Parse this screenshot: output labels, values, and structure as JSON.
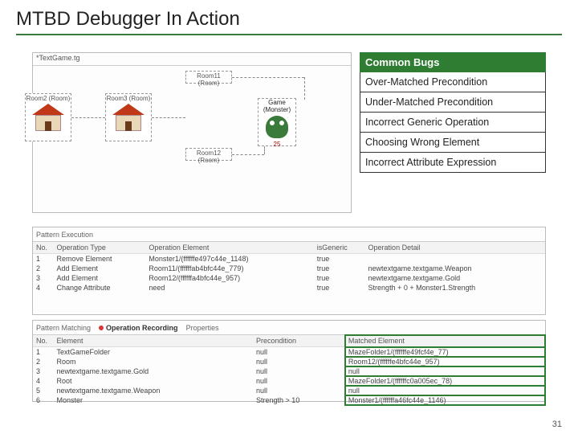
{
  "title": "MTBD Debugger In Action",
  "canvas_tab": "*TextGame.tg",
  "rooms": {
    "r2": "Room2 (Room)",
    "r3": "Room3 (Room)",
    "r11": "Room11 (Room)",
    "r12": "Room12 (Room)"
  },
  "monster": {
    "label": "Game (Monster)",
    "hp": "25"
  },
  "bugs": {
    "header": "Common Bugs",
    "items": [
      "Over-Matched Precondition",
      "Under-Matched Precondition",
      "Incorrect Generic Operation",
      "Choosing Wrong Element",
      "Incorrect Attribute Expression"
    ]
  },
  "exec": {
    "tab": "Pattern Execution",
    "headers": [
      "No.",
      "Operation Type",
      "Operation Element",
      "isGeneric",
      "Operation Detail"
    ],
    "rows": [
      [
        "1",
        "Remove Element",
        "Monster1/(ffffffe497c44e_1148)",
        "true",
        ""
      ],
      [
        "2",
        "Add Element",
        "Room11/(ffffffab4bfc44e_779)",
        "true",
        "newtextgame.textgame.Weapon"
      ],
      [
        "3",
        "Add Element",
        "Room12/(ffffffa4bfc44e_957)",
        "true",
        "newtextgame.textgame.Gold"
      ],
      [
        "4",
        "Change Attribute",
        "need",
        "true",
        "Strength + 0 + Monster1.Strength"
      ]
    ]
  },
  "match": {
    "tabs": [
      "Pattern Matching",
      "Operation Recording",
      "Properties"
    ],
    "headers": [
      "No.",
      "Element",
      "Precondition",
      "Matched Element"
    ],
    "rows": [
      [
        "1",
        "TextGameFolder",
        "null",
        "MazeFolder1/(ffffffe49fcf4e_77)"
      ],
      [
        "2",
        "Room",
        "null",
        "Room12/(ffffffe4bfc44e_957)"
      ],
      [
        "3",
        "newtextgame.textgame.Gold",
        "null",
        "null"
      ],
      [
        "4",
        "Root",
        "null",
        "MazeFolder1/(ffffffc0a005ec_78)"
      ],
      [
        "5",
        "newtextgame.textgame.Weapon",
        "null",
        "null"
      ],
      [
        "6",
        "Monster",
        "Strength > 10",
        "Monster1/(ffffffa46fc44e_1146)"
      ]
    ]
  },
  "page": "31"
}
